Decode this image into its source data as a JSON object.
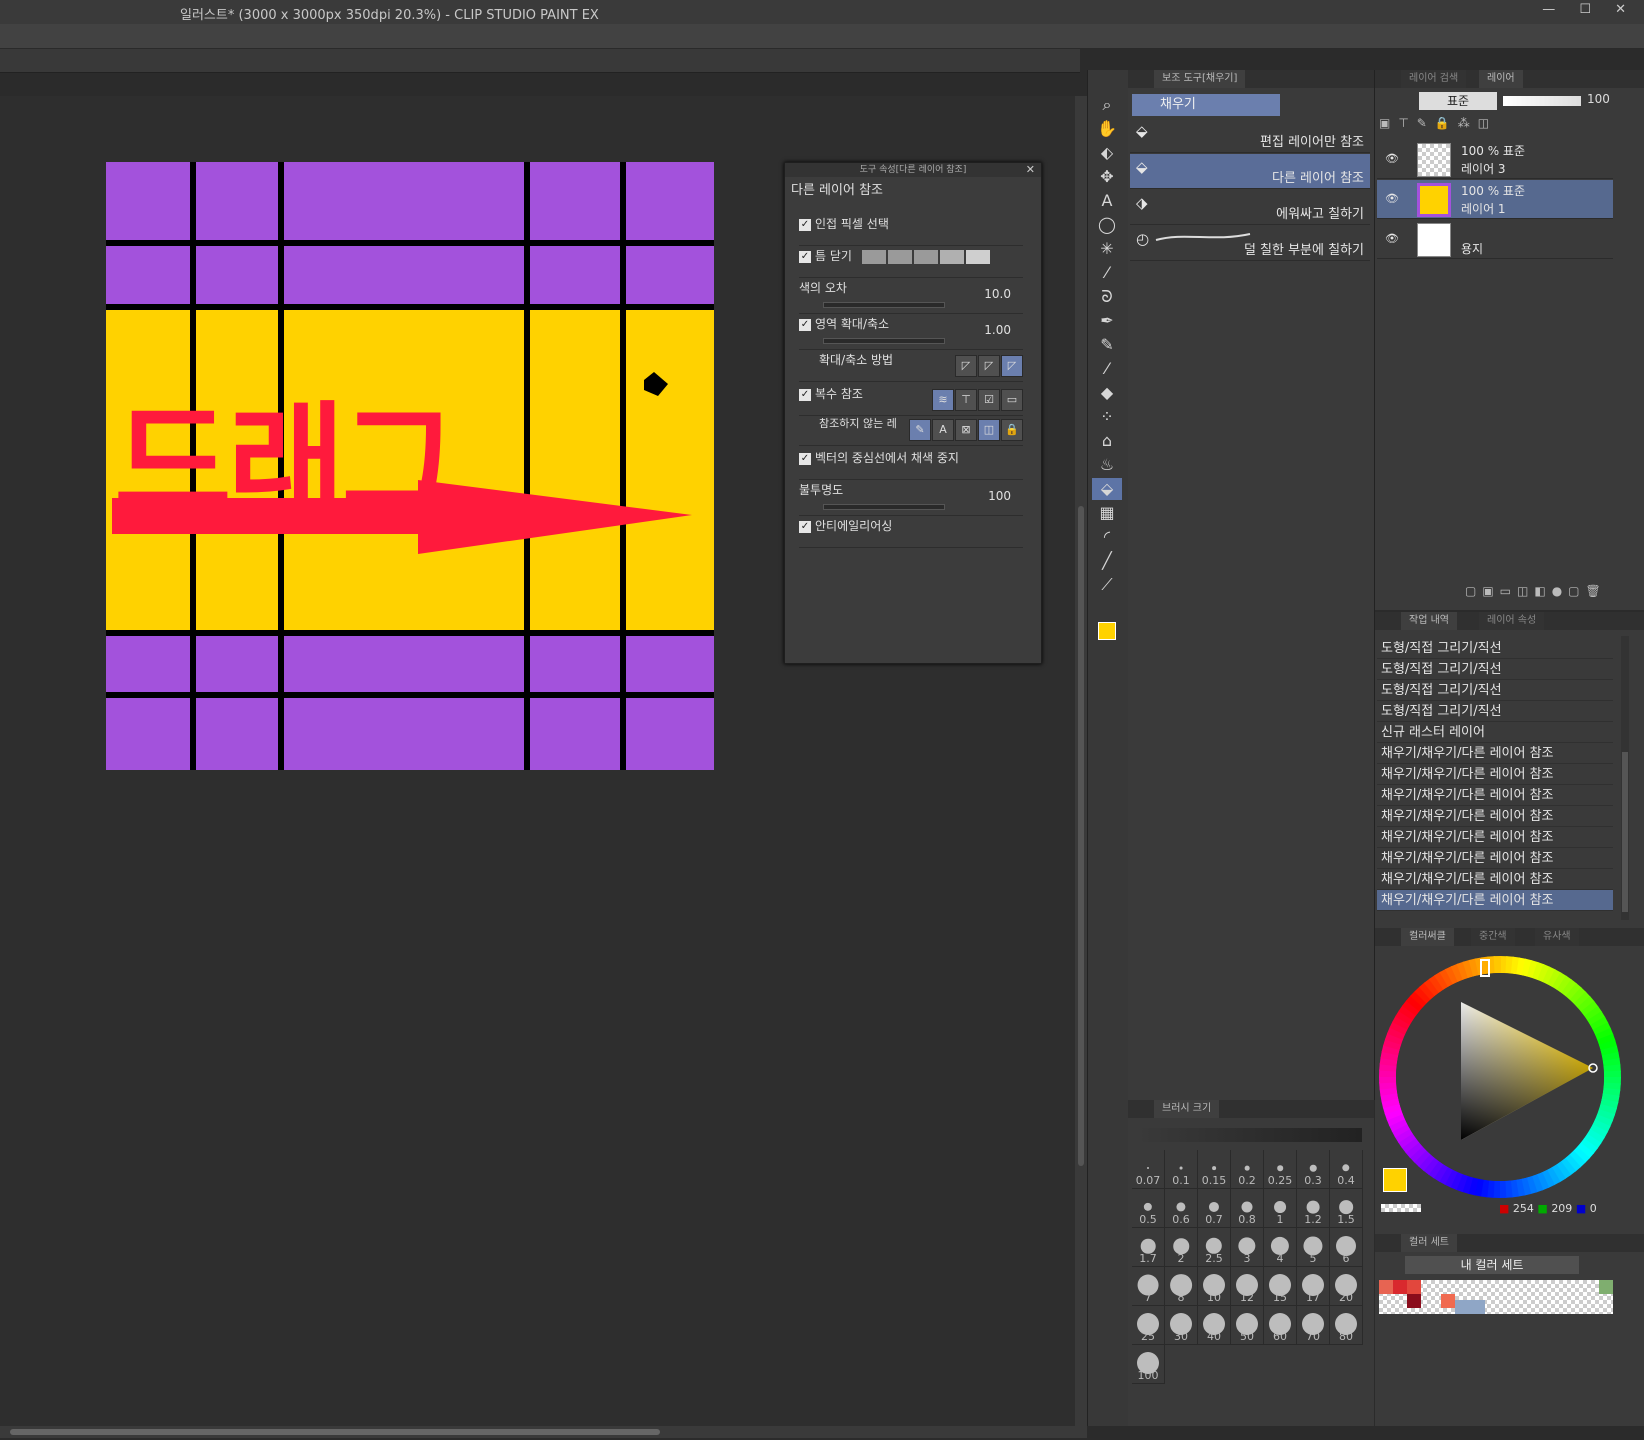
{
  "window": {
    "title": "일러스트* (3000 x 3000px 350dpi 20.3%)  - CLIP STUDIO PAINT EX",
    "controls": "— ☐ ✕"
  },
  "canvas": {
    "overlay_text": "드래그",
    "colors": {
      "purple": "#a352dc",
      "yellow": "#ffd200",
      "arrow": "#ff1a3c",
      "line": "#000000"
    }
  },
  "tool_props": {
    "header": "도구 속성[다른 레이어 참조]",
    "subtitle": "다른 레이어 참조",
    "close_label": "✕",
    "rows": {
      "adjacent": "인접 픽셀 선택",
      "close_gap": "틈 닫기",
      "tolerance_label": "색의 오차",
      "tolerance_value": "10.0",
      "area_scale_label": "영역 확대/축소",
      "area_scale_value": "1.00",
      "scale_method_label": "확대/축소 방법",
      "multi_ref_label": "복수 참조",
      "no_ref_label": "참조하지 않는 레",
      "vector_center_label": "벡터의 중심선에서 채색 중지",
      "opacity_label": "불투명도",
      "opacity_value": "100",
      "antialias_label": "안티에일리어싱"
    }
  },
  "sub_tool": {
    "tab_label": "보조 도구[채우기]",
    "group_label": "채우기",
    "items": [
      {
        "label": "편집 레이어만 참조",
        "selected": false
      },
      {
        "label": "다른 레이어 참조",
        "selected": true
      },
      {
        "label": "에워싸고 칠하기",
        "selected": false
      },
      {
        "label": "덜 칠한 부분에 칠하기",
        "selected": false
      }
    ]
  },
  "brush_size": {
    "tab_label": "브러시 크기",
    "sizes": [
      "0.07",
      "0.1",
      "0.15",
      "0.2",
      "0.25",
      "0.3",
      "0.4",
      "0.5",
      "0.6",
      "0.7",
      "0.8",
      "1",
      "1.2",
      "1.5",
      "1.7",
      "2",
      "2.5",
      "3",
      "4",
      "5",
      "6",
      "7",
      "8",
      "10",
      "12",
      "15",
      "17",
      "20",
      "25",
      "30",
      "40",
      "50",
      "60",
      "70",
      "80",
      "100"
    ]
  },
  "layer_panel": {
    "tab_search": "레이어 검색",
    "tab_layer": "레이어",
    "blend_mode": "표준",
    "opacity": "100",
    "layers": [
      {
        "mode": "100 % 표준",
        "name": "레이어 3",
        "selected": false,
        "thumb": "checker"
      },
      {
        "mode": "100 % 표준",
        "name": "레이어 1",
        "selected": true,
        "thumb": "yellow"
      },
      {
        "mode": "",
        "name": "용지",
        "selected": false,
        "thumb": "white"
      }
    ]
  },
  "history": {
    "tab_label": "작업 내역",
    "tab_layer_props": "레이어 속성",
    "items": [
      {
        "label": "도형/직접 그리기/직선",
        "selected": false
      },
      {
        "label": "도형/직접 그리기/직선",
        "selected": false
      },
      {
        "label": "도형/직접 그리기/직선",
        "selected": false
      },
      {
        "label": "도형/직접 그리기/직선",
        "selected": false
      },
      {
        "label": "신규 래스터 레이어",
        "selected": false
      },
      {
        "label": "채우기/채우기/다른 레이어 참조",
        "selected": false
      },
      {
        "label": "채우기/채우기/다른 레이어 참조",
        "selected": false
      },
      {
        "label": "채우기/채우기/다른 레이어 참조",
        "selected": false
      },
      {
        "label": "채우기/채우기/다른 레이어 참조",
        "selected": false
      },
      {
        "label": "채우기/채우기/다른 레이어 참조",
        "selected": false
      },
      {
        "label": "채우기/채우기/다른 레이어 참조",
        "selected": false
      },
      {
        "label": "채우기/채우기/다른 레이어 참조",
        "selected": false
      },
      {
        "label": "채우기/채우기/다른 레이어 참조",
        "selected": true
      }
    ]
  },
  "color_wheel": {
    "tab_label": "컬러써클",
    "tab_mid": "중간색",
    "tab_similar": "유사색",
    "r": "254",
    "g": "209",
    "b": "0",
    "main_color": "#ffd200",
    "sub_color": "#c98b83"
  },
  "color_set": {
    "tab_label": "컬러 세트",
    "set_name": "내 컬러 세트"
  }
}
